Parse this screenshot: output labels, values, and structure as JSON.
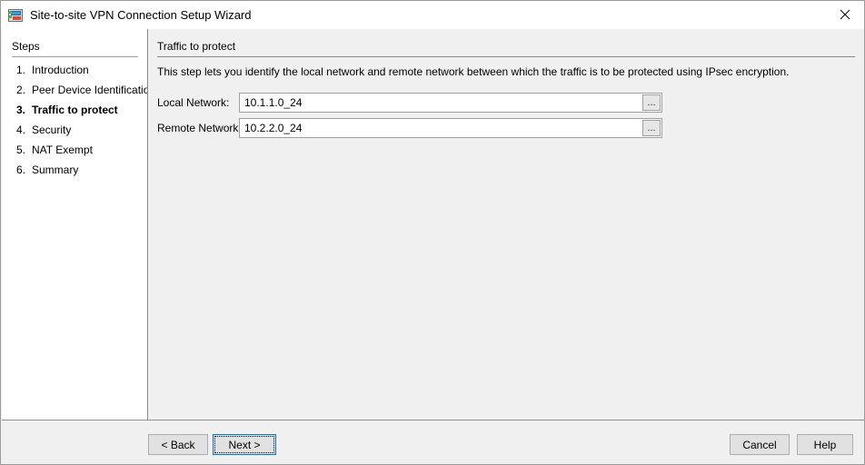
{
  "window": {
    "title": "Site-to-site VPN Connection Setup Wizard",
    "icon": "vpn-wizard-icon",
    "close_icon": "close-icon"
  },
  "sidebar": {
    "header": "Steps",
    "items": [
      {
        "num": "1.",
        "label": "Introduction",
        "current": false
      },
      {
        "num": "2.",
        "label": "Peer Device Identificatio",
        "current": false
      },
      {
        "num": "3.",
        "label": "Traffic to protect",
        "current": true
      },
      {
        "num": "4.",
        "label": "Security",
        "current": false
      },
      {
        "num": "5.",
        "label": "NAT Exempt",
        "current": false
      },
      {
        "num": "6.",
        "label": "Summary",
        "current": false
      }
    ]
  },
  "content": {
    "title": "Traffic to protect",
    "description": "This step lets you identify the local network and remote network between which the traffic is to be protected using IPsec encryption.",
    "fields": [
      {
        "label": "Local Network:",
        "value": "10.1.1.0_24",
        "placeholder": "",
        "browse_label": "..."
      },
      {
        "label": "Remote Network:",
        "value": "10.2.2.0_24",
        "placeholder": "",
        "browse_label": "..."
      }
    ]
  },
  "footer": {
    "back_label": "< Back",
    "next_label": "Next >",
    "cancel_label": "Cancel",
    "help_label": "Help"
  },
  "colors": {
    "focus_border": "#0078d7",
    "window_bg": "#f0f0f0",
    "panel_bg": "#ffffff",
    "rule": "#8a8a8a"
  }
}
